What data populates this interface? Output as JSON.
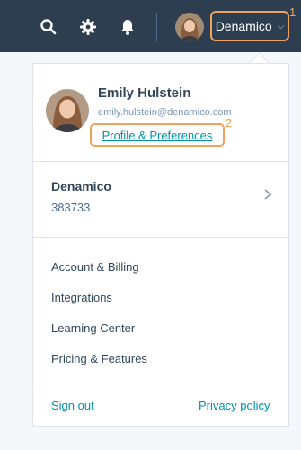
{
  "topbar": {
    "icons": [
      "search-icon",
      "gear-icon",
      "bell-icon"
    ],
    "account_label": "Denamico",
    "callout_1": "1"
  },
  "user": {
    "name": "Emily Hulstein",
    "email": "emily.hulstein@denamico.com",
    "profile_link": "Profile & Preferences",
    "callout_2": "2"
  },
  "portal": {
    "name": "Denamico",
    "id": "383733"
  },
  "menu": {
    "items": [
      {
        "label": "Account & Billing"
      },
      {
        "label": "Integrations"
      },
      {
        "label": "Learning Center"
      },
      {
        "label": "Pricing & Features"
      }
    ]
  },
  "footer": {
    "sign_out": "Sign out",
    "privacy": "Privacy policy"
  },
  "colors": {
    "topbar": "#2d3e50",
    "accent_link": "#0091ae",
    "highlight": "#f2a25c"
  }
}
